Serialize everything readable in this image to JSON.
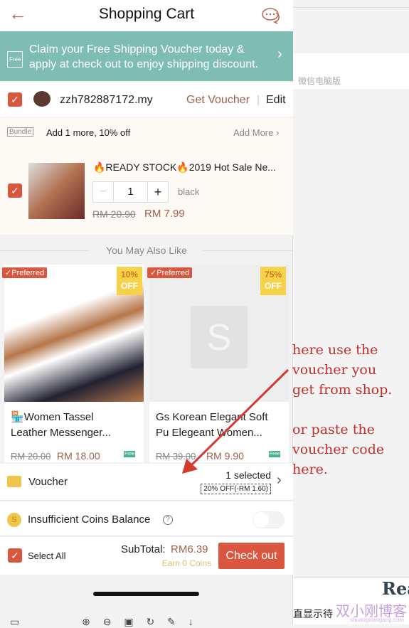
{
  "header": {
    "title": "Shopping Cart",
    "back_icon": "arrow-left-icon",
    "chat_icon": "chat-icon"
  },
  "banner": {
    "line1": "Claim your Free Shipping Voucher today &",
    "line2": "apply at check out to enjoy shipping discount.",
    "badge": "Free"
  },
  "shop": {
    "name": "zzh782887172.my",
    "get_voucher": "Get Voucher",
    "edit": "Edit"
  },
  "bundle": {
    "tag": "Bundle",
    "text": "Add 1 more, 10% off",
    "add_more": "Add More"
  },
  "item": {
    "title": "🔥READY STOCK🔥2019 Hot Sale Ne...",
    "qty": "1",
    "variation": "black",
    "old_price": "RM 20.90",
    "price": "RM 7.99"
  },
  "recommend": {
    "heading": "You May Also Like",
    "products": [
      {
        "badge": "Preferred",
        "discount": "10%",
        "off": "OFF",
        "name": "Women Tassel Leather Messenger...",
        "old_price": "RM 20.00",
        "price": "RM 18.00",
        "ship": "Free"
      },
      {
        "badge": "Preferred",
        "discount": "75%",
        "off": "OFF",
        "name": "Gs Korean Elegant Soft Pu Elegeant Women...",
        "old_price": "RM 39.00",
        "price": "RM 9.90",
        "ship": "Free"
      }
    ]
  },
  "voucher": {
    "label": "Voucher",
    "selected": "1 selected",
    "applied": "20% OFF(-RM 1.60)"
  },
  "coins": {
    "label": "Insufficient Coins Balance",
    "toggle_on": false
  },
  "footer": {
    "select_all": "Select All",
    "subtotal_label": "SubTotal:",
    "subtotal": "RM6.39",
    "earn": "Earn 0 Coins",
    "checkout": "Check out"
  },
  "background": {
    "wechat_label": "微信电脑版",
    "bottom_text": "直显示待",
    "right_text": "Rea"
  },
  "annotation": {
    "lines": [
      "here use the",
      "voucher you",
      "get from shop.",
      "",
      "or paste the",
      "voucher code",
      "here."
    ]
  },
  "watermark": {
    "text": "双小刚博客",
    "url": "shuangxiaogang.com"
  },
  "colors": {
    "accent": "#d9573f",
    "teal": "#7fbcb3",
    "annotation": "#c0302a"
  }
}
